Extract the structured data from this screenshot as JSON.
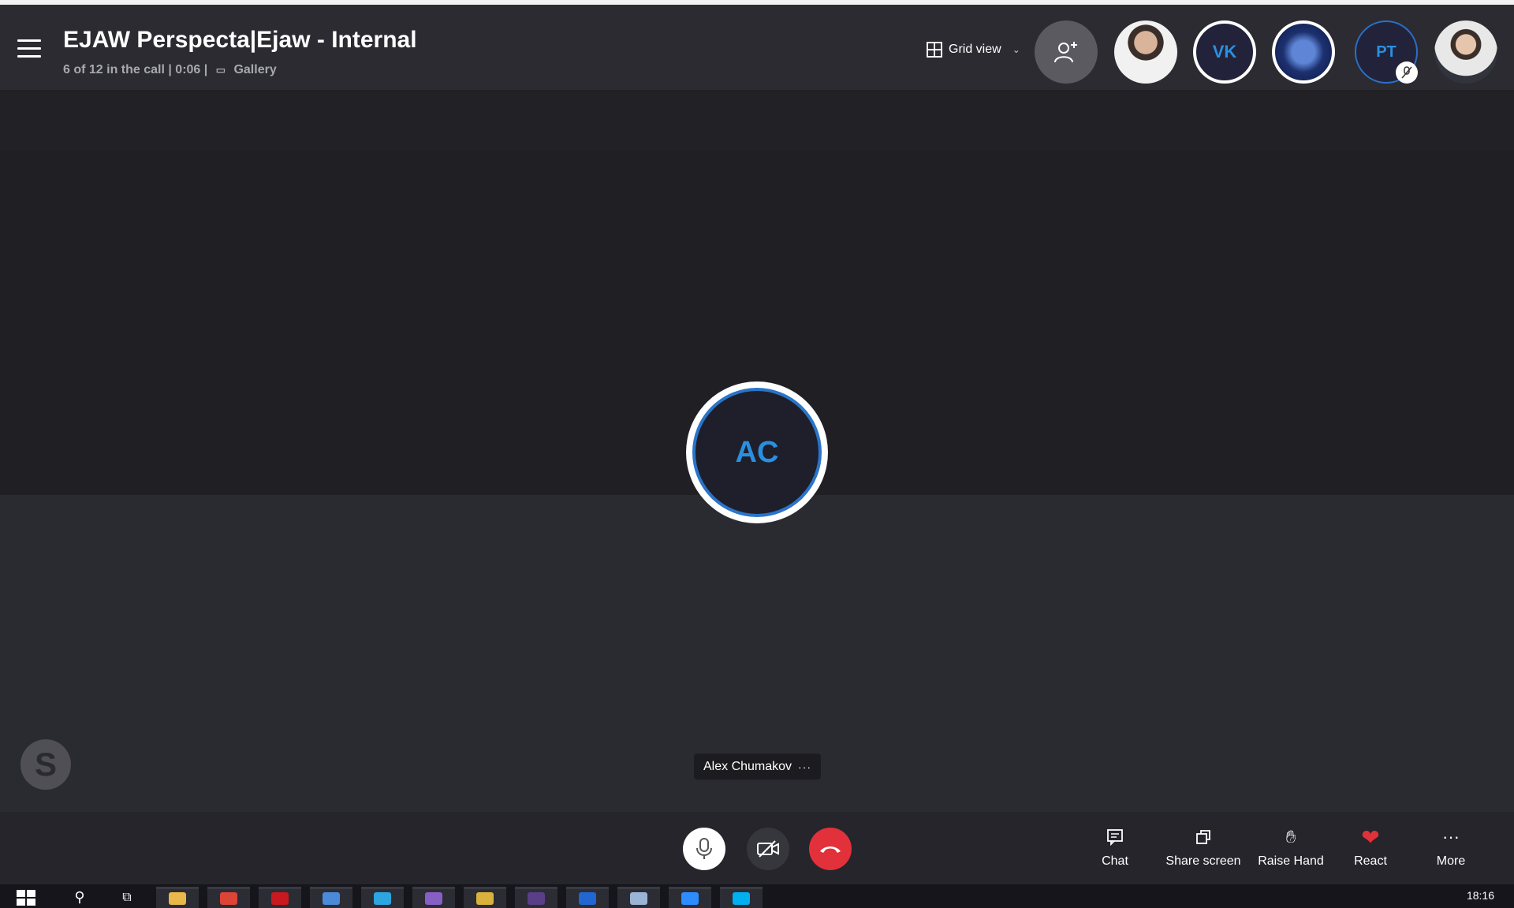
{
  "header": {
    "title": "EJAW Perspecta|Ejaw - Internal",
    "subtitle_prefix": "6 of 12 in the call | 0:06 |",
    "gallery_label": "Gallery",
    "grid_view_label": "Grid view"
  },
  "participants": {
    "vk_initials": "VK",
    "pt_initials": "PT"
  },
  "stage": {
    "active_initials": "AC",
    "active_name": "Alex Chumakov",
    "name_more": "···",
    "skype_logo": "S"
  },
  "actions": {
    "chat": "Chat",
    "share": "Share screen",
    "raise_hand": "Raise Hand",
    "react": "React",
    "more": "More"
  },
  "taskbar": {
    "clock": "18:16",
    "apps": [
      {
        "name": "file-explorer",
        "color": "#e8b84a"
      },
      {
        "name": "chrome",
        "color": "#db4437"
      },
      {
        "name": "opera",
        "color": "#c8191f"
      },
      {
        "name": "shield-app",
        "color": "#4b8ad8"
      },
      {
        "name": "telegram",
        "color": "#2ca5e0"
      },
      {
        "name": "visual-studio",
        "color": "#865fc5"
      },
      {
        "name": "sticky-notes",
        "color": "#d9b23c"
      },
      {
        "name": "terminal",
        "color": "#5b3e88"
      },
      {
        "name": "maps-app",
        "color": "#2166d1"
      },
      {
        "name": "notepad",
        "color": "#9ab4d6"
      },
      {
        "name": "zoom",
        "color": "#2d8cff"
      },
      {
        "name": "skype",
        "color": "#00aff0"
      }
    ]
  },
  "colors": {
    "accent": "#2b8fe0",
    "hangup": "#e2313a",
    "background": "#25252c"
  }
}
